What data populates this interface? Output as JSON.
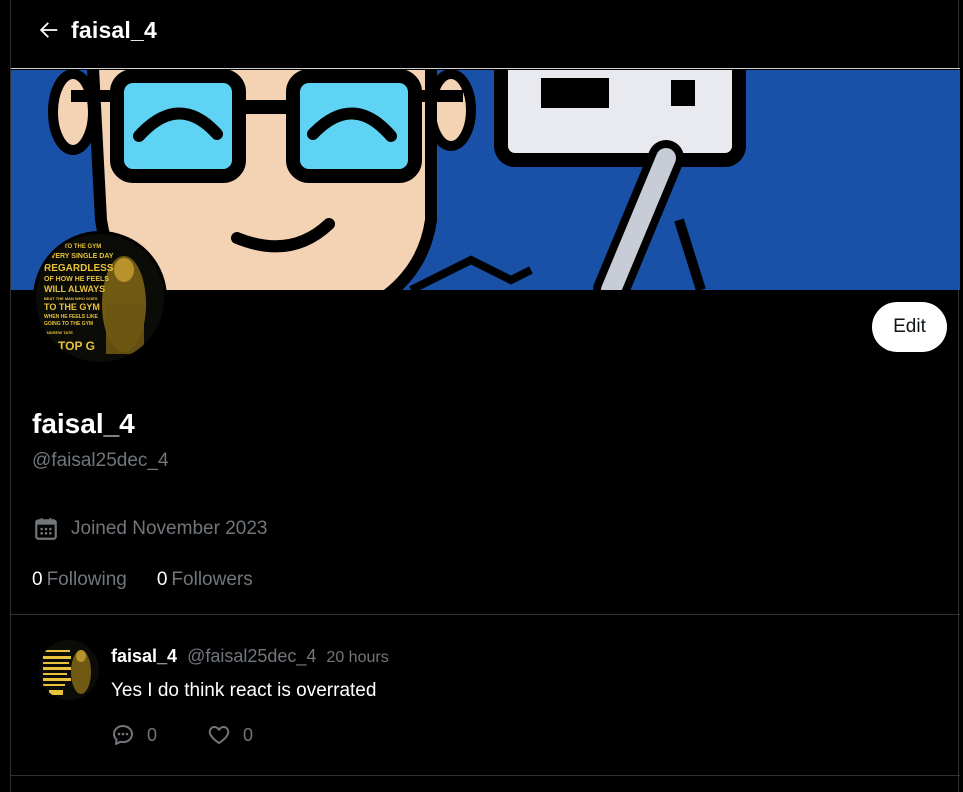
{
  "header": {
    "title": "faisal_4",
    "back_icon": "arrow-left-icon"
  },
  "banner": {
    "background_color": "#1a51a8",
    "image": "cartoon-face-with-glasses-banner"
  },
  "profile": {
    "name": "faisal_4",
    "handle": "@faisal25dec_4",
    "joined": "Joined November 2023",
    "joined_icon": "calendar-icon",
    "following_count": "0",
    "following_label": "Following",
    "followers_count": "0",
    "followers_label": "Followers",
    "edit_label": "Edit",
    "avatar_lines": [
      "TO THE GYM",
      "EVERY SINGLE DAY",
      "REGARDLESS",
      "OF HOW HE FEELS",
      "WILL ALWAYS",
      "BEAT THE MAN WHO GOES",
      "TO THE GYM",
      "WHEN HE FEELS LIKE",
      "GOING TO THE GYM",
      "ANDREW TATE",
      "TOP G"
    ]
  },
  "post": {
    "author_name": "faisal_4",
    "author_handle": "@faisal25dec_4",
    "time": "20 hours",
    "text": "Yes I do think react is overrated",
    "reply_count": "0",
    "like_count": "0",
    "reply_icon": "comment-icon",
    "like_icon": "heart-icon"
  },
  "colors": {
    "background": "#000000",
    "muted_text": "#71767b",
    "border": "#2f3336",
    "gold": "#d4a82a"
  }
}
